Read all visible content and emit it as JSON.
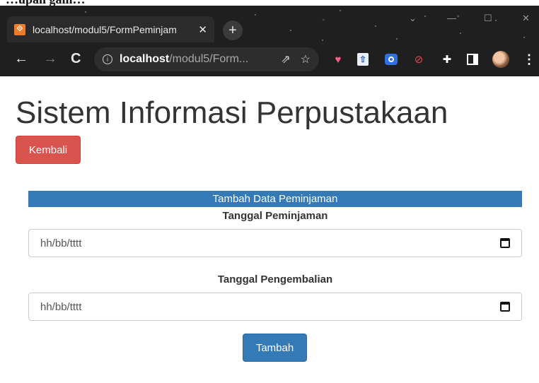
{
  "caption": "...upan gam...",
  "browser": {
    "tab_title": "localhost/modul5/FormPeminjam",
    "tab_close": "✕",
    "new_tab": "+",
    "url_host": "localhost",
    "url_path": "/modul5/Form..."
  },
  "page": {
    "title": "Sistem Informasi Perpustakaan",
    "back_button": "Kembali"
  },
  "form": {
    "header": "Tambah Data Peminjaman",
    "loan_date_label": "Tanggal Peminjaman",
    "loan_date_placeholder": "hh/bb/tttt",
    "return_date_label": "Tanggal Pengembalian",
    "return_date_placeholder": "hh/bb/tttt",
    "submit_button": "Tambah"
  },
  "icons": [
    "back-arrow-icon",
    "forward-arrow-icon",
    "reload-icon",
    "info-icon",
    "share-icon",
    "star-icon",
    "calendar-icon"
  ]
}
